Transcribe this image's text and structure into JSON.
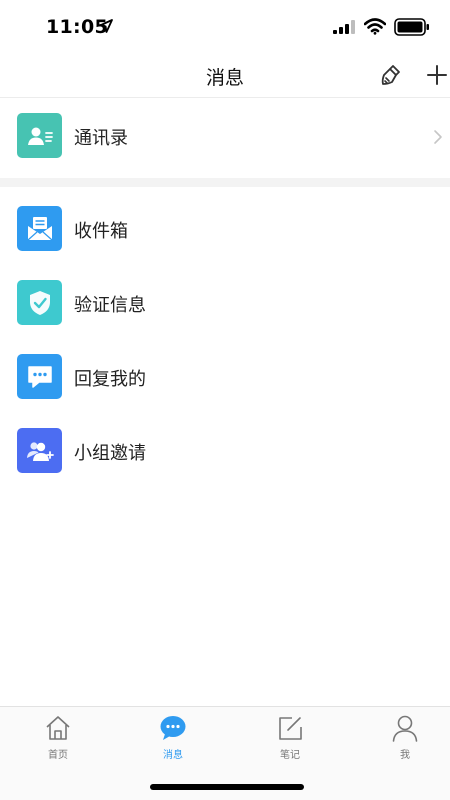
{
  "status_bar": {
    "time": "11:05",
    "icons": [
      "location-arrow-icon",
      "cellular-signal-icon",
      "wifi-icon",
      "battery-icon"
    ]
  },
  "header": {
    "title": "消息",
    "actions": [
      "broom-icon",
      "plus-icon"
    ]
  },
  "contacts": {
    "label": "通讯录",
    "icon": "contact-card-icon",
    "color": "#47c3b2"
  },
  "messages": [
    {
      "label": "收件箱",
      "icon": "mail-inbox-icon",
      "color": "#2f9bf0"
    },
    {
      "label": "验证信息",
      "icon": "shield-check-icon",
      "color": "#3ec9cf"
    },
    {
      "label": "回复我的",
      "icon": "chat-bubble-icon",
      "color": "#2f9bf0"
    },
    {
      "label": "小组邀请",
      "icon": "group-add-icon",
      "color": "#4c6df2"
    }
  ],
  "tabs": [
    {
      "label": "首页",
      "icon": "home-icon",
      "active": false
    },
    {
      "label": "消息",
      "icon": "chat-bubble-icon",
      "active": true
    },
    {
      "label": "笔记",
      "icon": "edit-note-icon",
      "active": false
    },
    {
      "label": "我",
      "icon": "person-icon",
      "active": false
    }
  ],
  "colors": {
    "accent": "#2f9bf0",
    "tab_inactive": "#777777",
    "section_gap": "#f3f3f3"
  }
}
